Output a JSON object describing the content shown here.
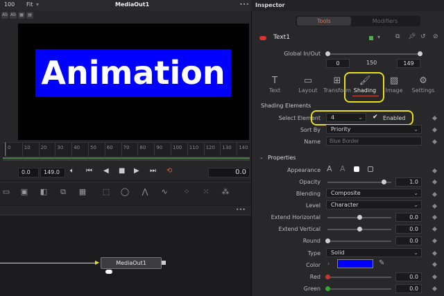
{
  "viewer": {
    "zoom": "100",
    "fit": "Fit",
    "title": "MediaOut1",
    "banner_text": "Animation",
    "ruler_ticks": [
      "0",
      "10",
      "20",
      "30",
      "40",
      "50",
      "60",
      "70",
      "80",
      "90",
      "100",
      "110",
      "120",
      "130",
      "140"
    ],
    "current_time": "0.0",
    "end_time": "149.0",
    "timecode": "0.0"
  },
  "nodes": {
    "node_label": "MediaOut1"
  },
  "inspector": {
    "title": "Inspector",
    "tabs": {
      "tools": "Tools",
      "modifiers": "Modifiers"
    },
    "tool_name": "Text1",
    "global_label": "Global In/Out",
    "global_in": "0",
    "global_mid": "150",
    "global_out": "149",
    "categories": [
      {
        "label": "Text",
        "icon": "T"
      },
      {
        "label": "Layout",
        "icon": "▭"
      },
      {
        "label": "Transform",
        "icon": "⊞"
      },
      {
        "label": "Shading",
        "icon": "🖌"
      },
      {
        "label": "Image",
        "icon": "▨"
      },
      {
        "label": "Settings",
        "icon": "⚙"
      }
    ],
    "shading_elements_header": "Shading Elements",
    "select_element_label": "Select Element",
    "select_element_value": "4",
    "enabled_label": "Enabled",
    "sort_by_label": "Sort By",
    "sort_by_value": "Priority",
    "name_label": "Name",
    "name_placeholder": "Blue Border",
    "properties_header": "Properties",
    "appearance_label": "Appearance",
    "opacity_label": "Opacity",
    "opacity_value": "1.0",
    "blending_label": "Blending",
    "blending_value": "Composite",
    "level_label": "Level",
    "level_value": "Character",
    "extend_h_label": "Extend Horizontal",
    "extend_h_value": "0.0",
    "extend_v_label": "Extend Vertical",
    "extend_v_value": "0.0",
    "round_label": "Round",
    "round_value": "0.0",
    "type_label": "Type",
    "type_value": "Solid",
    "color_label": "Color",
    "color_swatch": "#0000ff",
    "red_label": "Red",
    "red_value": "0.0",
    "green_label": "Green",
    "green_value": "0.0"
  },
  "colors": {
    "accent": "#e07050",
    "highlight": "#e9e01c",
    "banner_bg": "#0000ff"
  }
}
